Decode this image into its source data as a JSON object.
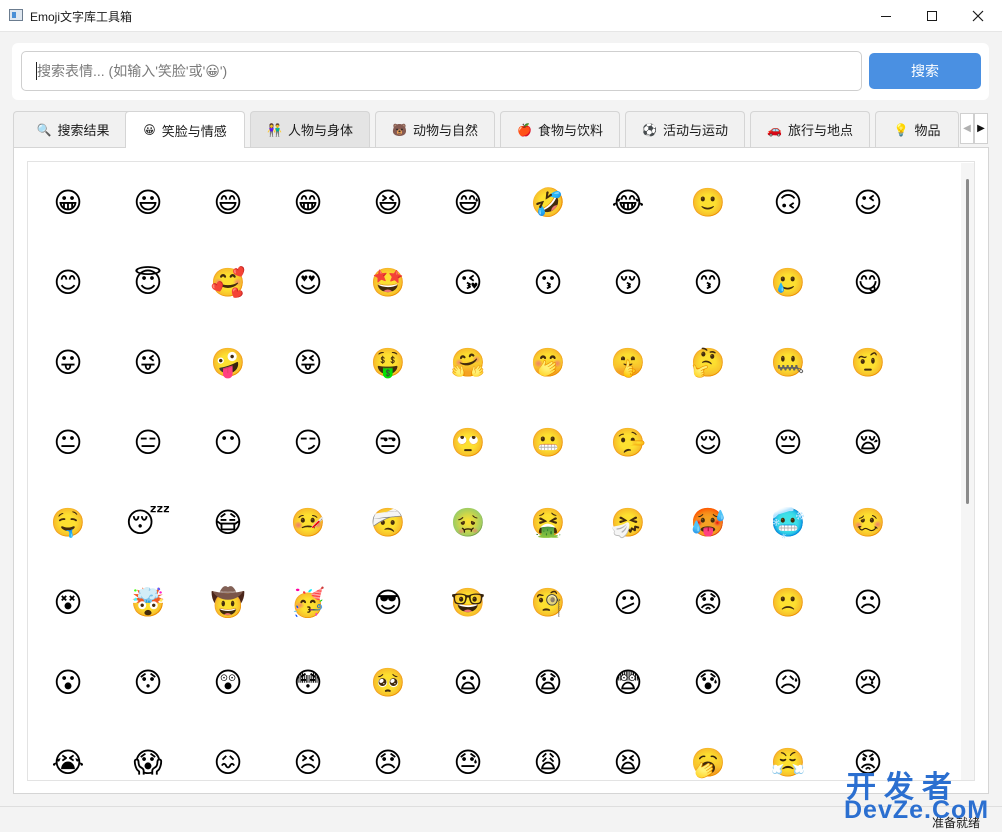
{
  "window": {
    "title": "Emoji文字库工具箱",
    "icons": {
      "app": "app-window-icon",
      "minimize": "minimize-icon",
      "maximize": "maximize-icon",
      "close": "close-icon"
    }
  },
  "search": {
    "placeholder": "搜索表情... (如输入'笑脸'或'😀')",
    "button_label": "搜索"
  },
  "tabs": [
    {
      "icon": "🔍",
      "label": "搜索结果",
      "state": "normal"
    },
    {
      "icon": "😀",
      "label": "笑脸与情感",
      "state": "selected"
    },
    {
      "icon": "👫",
      "label": "人物与身体",
      "state": "hover"
    },
    {
      "icon": "🐻",
      "label": "动物与自然",
      "state": "normal"
    },
    {
      "icon": "🍎",
      "label": "食物与饮料",
      "state": "normal"
    },
    {
      "icon": "⚽",
      "label": "活动与运动",
      "state": "normal"
    },
    {
      "icon": "🚗",
      "label": "旅行与地点",
      "state": "normal"
    },
    {
      "icon": "💡",
      "label": "物品",
      "state": "normal"
    }
  ],
  "tab_scroll": {
    "left": "◀",
    "right": "▶"
  },
  "emoji_rows": [
    [
      "😀",
      "😃",
      "😄",
      "😁",
      "😆",
      "😅",
      "🤣",
      "😂",
      "🙂",
      "🙃",
      "😉"
    ],
    [
      "😊",
      "😇",
      "🥰",
      "😍",
      "🤩",
      "😘",
      "😗",
      "😚",
      "😙",
      "🥲",
      "😋"
    ],
    [
      "😛",
      "😜",
      "🤪",
      "😝",
      "🤑",
      "🤗",
      "🤭",
      "🤫",
      "🤔",
      "🤐",
      "🤨"
    ],
    [
      "😐",
      "😑",
      "😶",
      "😏",
      "😒",
      "🙄",
      "😬",
      "🤥",
      "😌",
      "😔",
      "😪"
    ],
    [
      "🤤",
      "😴",
      "😷",
      "🤒",
      "🤕",
      "🤢",
      "🤮",
      "🤧",
      "🥵",
      "🥶",
      "🥴"
    ],
    [
      "😵",
      "🤯",
      "🤠",
      "🥳",
      "😎",
      "🤓",
      "🧐",
      "😕",
      "😟",
      "🙁",
      "☹"
    ],
    [
      "😮",
      "😯",
      "😲",
      "😳",
      "🥺",
      "😦",
      "😧",
      "😨",
      "😰",
      "😥",
      "😢"
    ],
    [
      "😭",
      "😱",
      "😖",
      "😣",
      "😞",
      "😓",
      "😩",
      "😫",
      "🥱",
      "😤",
      "😡"
    ]
  ],
  "status": {
    "text": "准备就绪"
  },
  "watermark": {
    "line1": "开发者",
    "line2": "DevZe.CoM"
  }
}
